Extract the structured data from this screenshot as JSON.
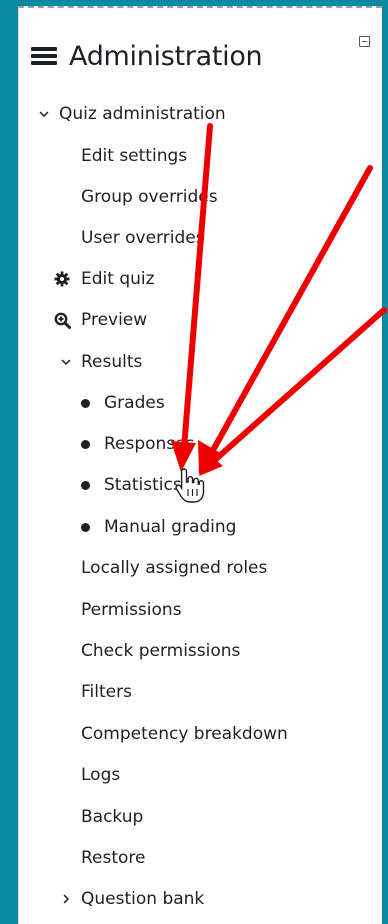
{
  "header": {
    "title": "Administration",
    "menu_icon": "hamburger-icon",
    "collapse_icon": "minus-square-icon"
  },
  "tree": {
    "quiz_admin": "Quiz administration",
    "edit_settings": "Edit settings",
    "group_overrides": "Group overrides",
    "user_overrides": "User overrides",
    "edit_quiz": "Edit quiz",
    "preview": "Preview",
    "results": "Results",
    "grades": "Grades",
    "responses": "Responses",
    "statistics": "Statistics",
    "manual_grading": "Manual grading",
    "locally_assigned_roles": "Locally assigned roles",
    "permissions": "Permissions",
    "check_permissions": "Check permissions",
    "filters": "Filters",
    "competency_breakdown": "Competency breakdown",
    "logs": "Logs",
    "backup": "Backup",
    "restore": "Restore",
    "question_bank": "Question bank"
  },
  "colors": {
    "frame": "#0a8aa0",
    "text": "#1d2125",
    "arrow": "#ee0000"
  }
}
